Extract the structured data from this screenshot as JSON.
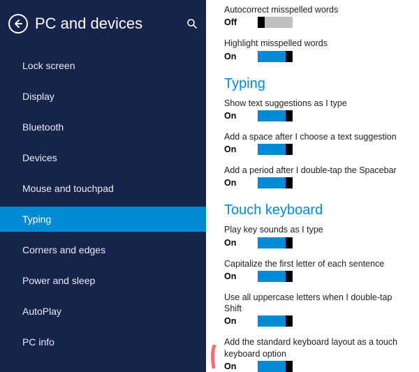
{
  "header": {
    "title": "PC and devices"
  },
  "sidebar": {
    "items": [
      {
        "label": "Lock screen"
      },
      {
        "label": "Display"
      },
      {
        "label": "Bluetooth"
      },
      {
        "label": "Devices"
      },
      {
        "label": "Mouse and touchpad"
      },
      {
        "label": "Typing"
      },
      {
        "label": "Corners and edges"
      },
      {
        "label": "Power and sleep"
      },
      {
        "label": "AutoPlay"
      },
      {
        "label": "PC info"
      }
    ],
    "selected_index": 5
  },
  "main": {
    "intro_options": [
      {
        "label": "Autocorrect misspelled words",
        "state": "Off",
        "on": false
      },
      {
        "label": "Highlight misspelled words",
        "state": "On",
        "on": true
      }
    ],
    "sections": [
      {
        "title": "Typing",
        "options": [
          {
            "label": "Show text suggestions as I type",
            "state": "On",
            "on": true
          },
          {
            "label": "Add a space after I choose a text suggestion",
            "state": "On",
            "on": true
          },
          {
            "label": "Add a period after I double-tap the Spacebar",
            "state": "On",
            "on": true
          }
        ]
      },
      {
        "title": "Touch keyboard",
        "options": [
          {
            "label": "Play key sounds as I type",
            "state": "On",
            "on": true
          },
          {
            "label": "Capitalize the first letter of each sentence",
            "state": "On",
            "on": true
          },
          {
            "label": "Use all uppercase letters when I double-tap Shift",
            "state": "On",
            "on": true
          },
          {
            "label": "Add the standard keyboard layout as a touch keyboard option",
            "state": "On",
            "on": true
          }
        ]
      }
    ]
  },
  "colors": {
    "accent": "#008bd4",
    "sidebar_bg": "#16234a",
    "annotation": "#f26f7a"
  }
}
